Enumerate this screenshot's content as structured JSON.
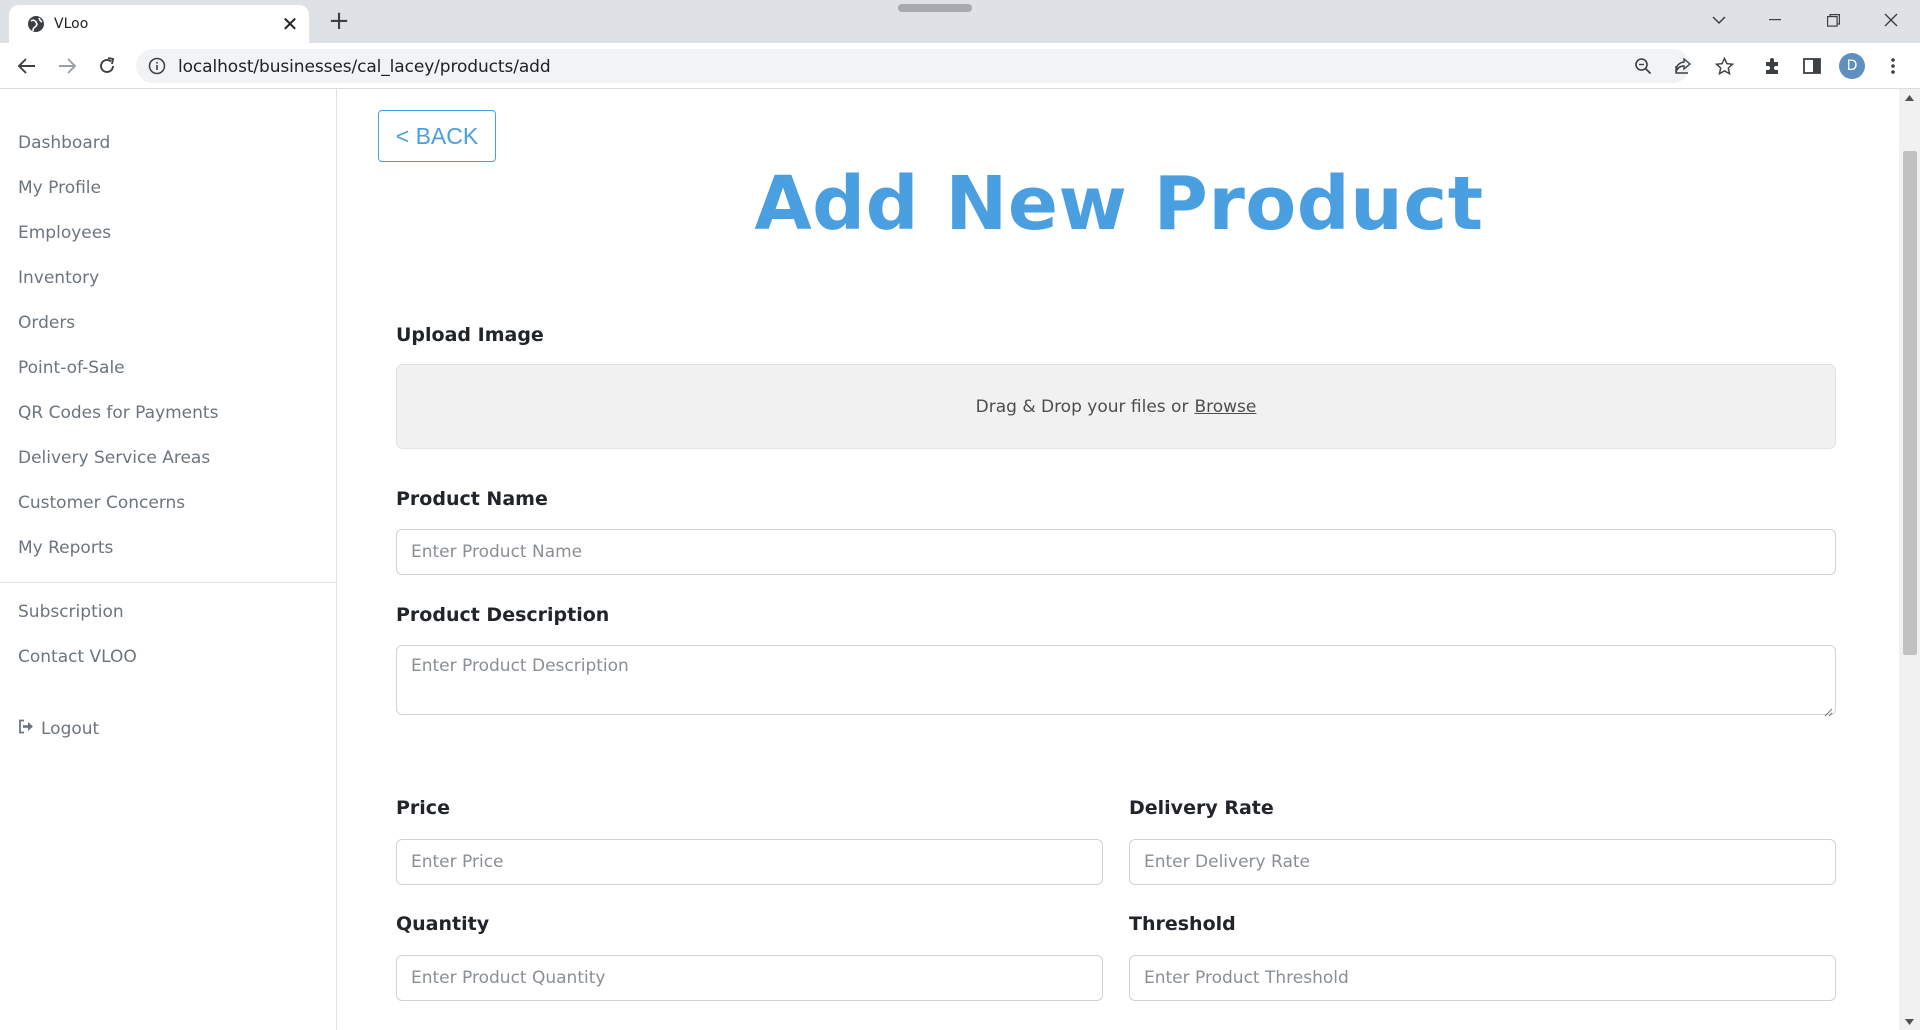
{
  "browser": {
    "tab_title": "VLoo",
    "url": "localhost/businesses/cal_lacey/products/add",
    "profile_initial": "D"
  },
  "sidebar": {
    "items": [
      {
        "label": "Dashboard"
      },
      {
        "label": "My Profile"
      },
      {
        "label": "Employees"
      },
      {
        "label": "Inventory"
      },
      {
        "label": "Orders"
      },
      {
        "label": "Point-of-Sale"
      },
      {
        "label": "QR Codes for Payments"
      },
      {
        "label": "Delivery Service Areas"
      },
      {
        "label": "Customer Concerns"
      },
      {
        "label": "My Reports"
      }
    ],
    "secondary_items": [
      {
        "label": "Subscription"
      },
      {
        "label": "Contact VLOO"
      }
    ],
    "logout_label": "Logout"
  },
  "main": {
    "back_label": "< BACK",
    "title": "Add New Product",
    "upload": {
      "label": "Upload Image",
      "drop_text": "Drag & Drop your files or",
      "browse_text": "Browse"
    },
    "fields": {
      "product_name": {
        "label": "Product Name",
        "placeholder": "Enter Product Name"
      },
      "product_description": {
        "label": "Product Description",
        "placeholder": "Enter Product Description"
      },
      "price": {
        "label": "Price",
        "placeholder": "Enter Price"
      },
      "delivery_rate": {
        "label": "Delivery Rate",
        "placeholder": "Enter Delivery Rate"
      },
      "quantity": {
        "label": "Quantity",
        "placeholder": "Enter Product Quantity"
      },
      "threshold": {
        "label": "Threshold",
        "placeholder": "Enter Product Threshold"
      }
    }
  },
  "colors": {
    "accent": "#4a9fe0",
    "sidebar_text": "#6c757d",
    "chrome_bg": "#dee1e6"
  }
}
